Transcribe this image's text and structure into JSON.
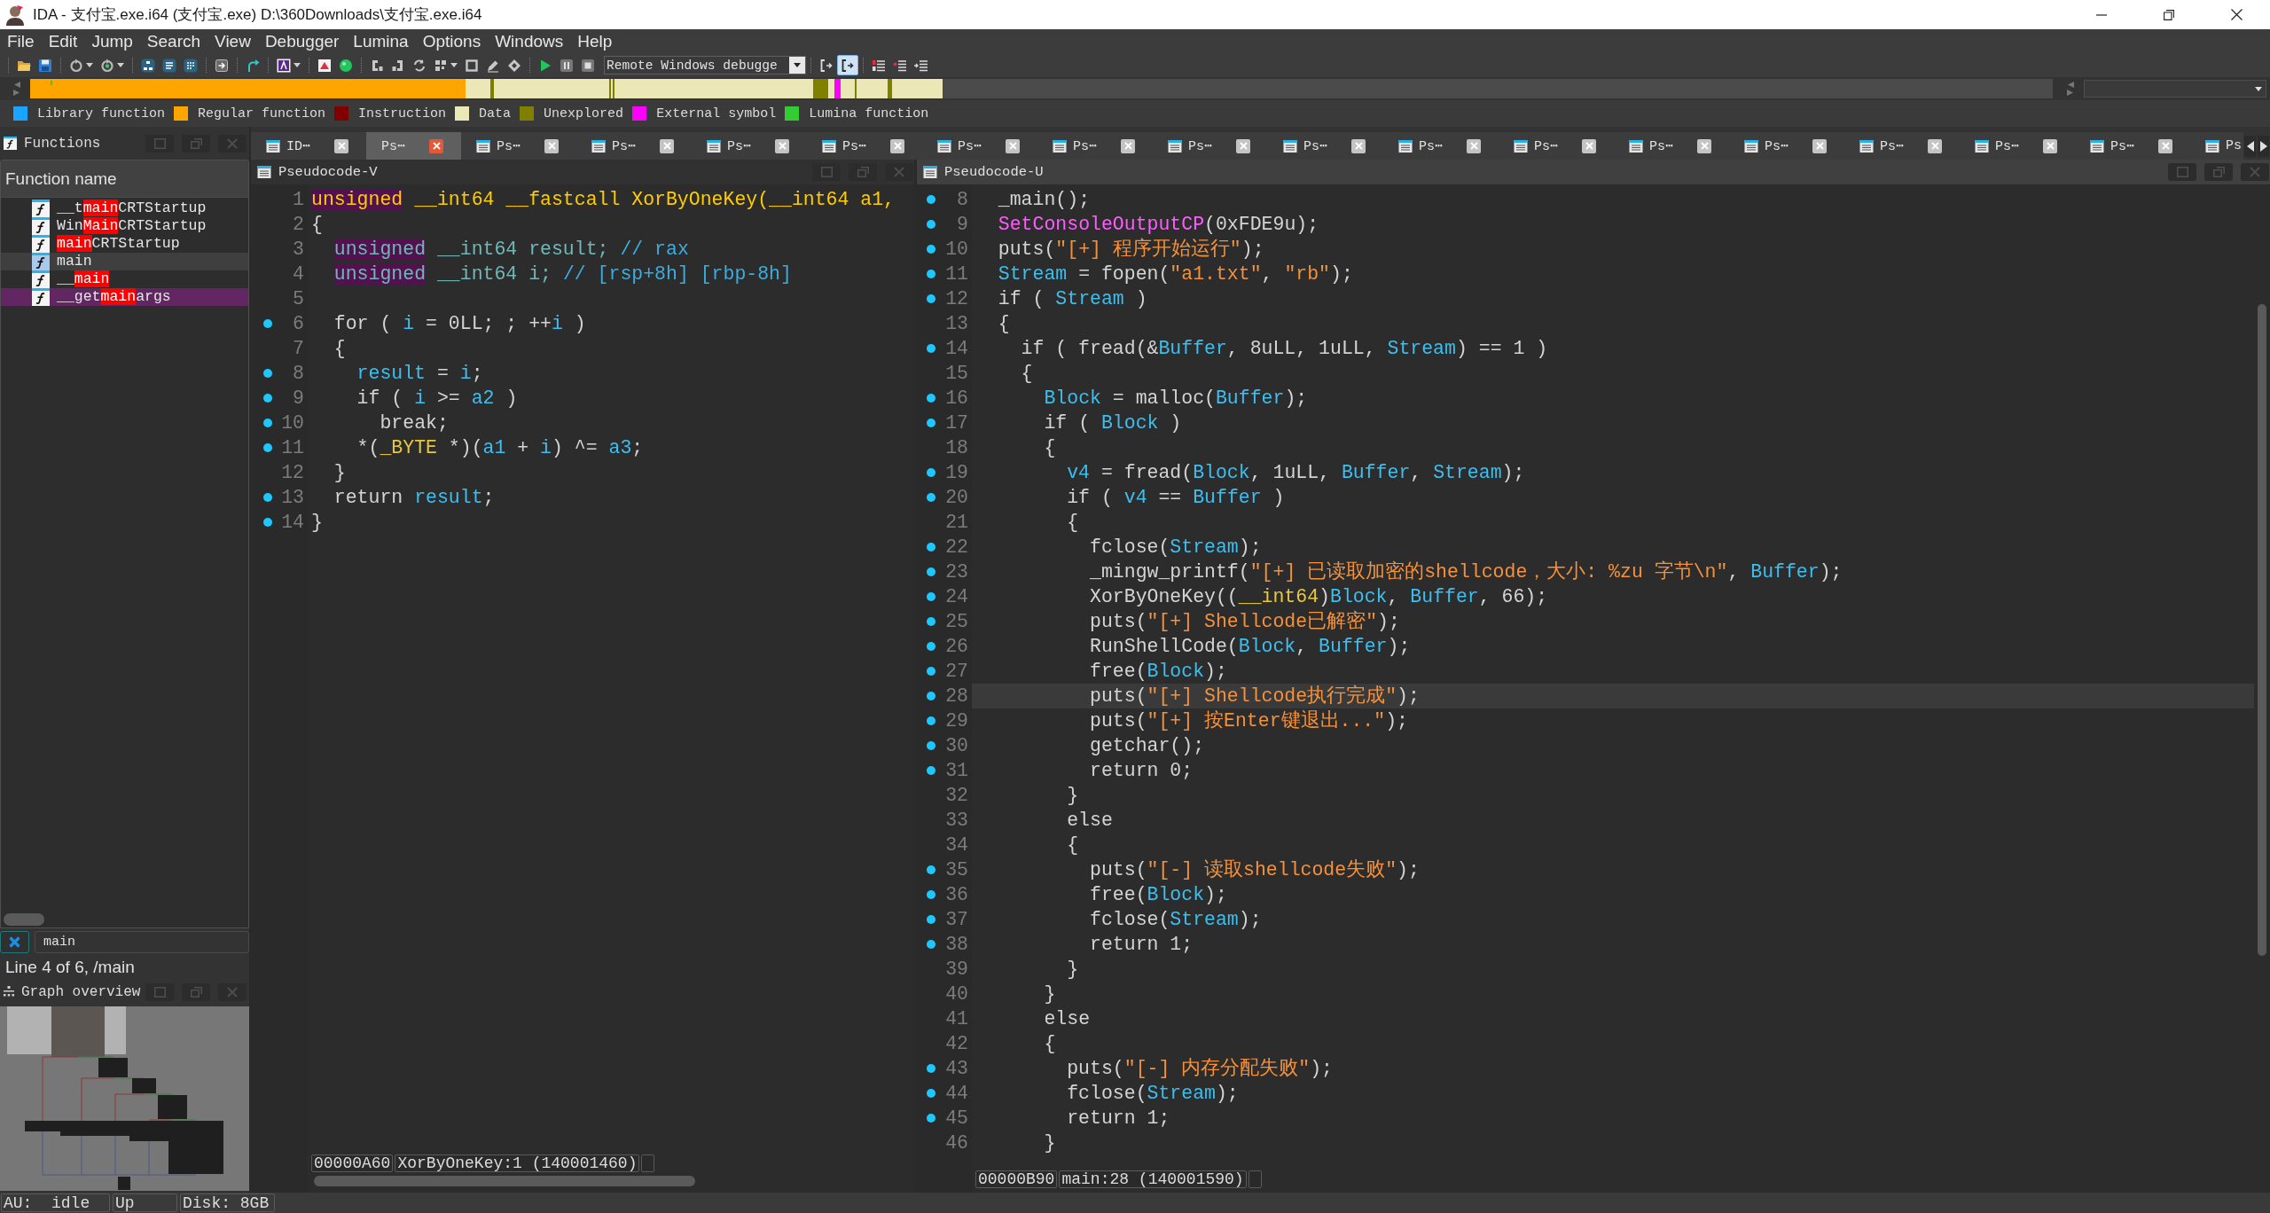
{
  "window": {
    "title": "IDA - 支付宝.exe.i64 (支付宝.exe) D:\\360Downloads\\支付宝.exe.i64"
  },
  "menu": [
    "File",
    "Edit",
    "Jump",
    "Search",
    "View",
    "Debugger",
    "Lumina",
    "Options",
    "Windows",
    "Help"
  ],
  "toolbar": {
    "debugger": "Remote Windows debugge",
    "toggles": [
      {
        "on": false
      },
      {
        "on": true
      }
    ]
  },
  "legend": [
    {
      "label": "Library function",
      "color": "#1aa3ff"
    },
    {
      "label": "Regular function",
      "color": "#ffa500"
    },
    {
      "label": "Instruction",
      "color": "#800000"
    },
    {
      "label": "Data",
      "color": "#ebe7b7"
    },
    {
      "label": "Unexplored",
      "color": "#808000"
    },
    {
      "label": "External symbol",
      "color": "#ff00ff"
    },
    {
      "label": "Lumina function",
      "color": "#33cc33"
    }
  ],
  "functions_panel": {
    "title": "Functions",
    "column": "Function name",
    "rows": [
      {
        "selected": false,
        "parts": [
          {
            "kind": "plain",
            "text": "__t"
          },
          {
            "kind": "match",
            "text": "main"
          },
          {
            "kind": "plain",
            "text": "CRTStartup"
          }
        ]
      },
      {
        "selected": false,
        "parts": [
          {
            "kind": "plain",
            "text": "Win"
          },
          {
            "kind": "match",
            "text": "Main"
          },
          {
            "kind": "plain",
            "text": "CRTStartup"
          }
        ]
      },
      {
        "selected": false,
        "parts": [
          {
            "kind": "match",
            "text": "main"
          },
          {
            "kind": "plain",
            "text": "CRTStartup"
          }
        ]
      },
      {
        "selected": true,
        "parts": [
          {
            "kind": "plain",
            "text": "main"
          }
        ]
      },
      {
        "selected": false,
        "parts": [
          {
            "kind": "plain",
            "text": "__"
          },
          {
            "kind": "match",
            "text": "main"
          }
        ]
      },
      {
        "selected": false,
        "color": "#622663",
        "parts": [
          {
            "kind": "plain",
            "text": "__get"
          },
          {
            "kind": "match",
            "text": "main"
          },
          {
            "kind": "plain",
            "text": "args"
          }
        ]
      }
    ],
    "filter": "main",
    "position": "Line 4 of 6, /main"
  },
  "graph_overview": {
    "title": "Graph overview"
  },
  "tabs": [
    {
      "label": "ID⋯",
      "selected": false,
      "closable": true
    },
    {
      "label": "Ps⋯",
      "selected": true,
      "closable": true
    },
    {
      "label": "Ps⋯",
      "selected": false,
      "closable": true
    },
    {
      "label": "Ps⋯",
      "selected": false,
      "closable": true
    },
    {
      "label": "Ps⋯",
      "selected": false,
      "closable": true
    },
    {
      "label": "Ps⋯",
      "selected": false,
      "closable": true
    },
    {
      "label": "Ps⋯",
      "selected": false,
      "closable": true
    },
    {
      "label": "Ps⋯",
      "selected": false,
      "closable": true
    },
    {
      "label": "Ps⋯",
      "selected": false,
      "closable": true
    },
    {
      "label": "Ps⋯",
      "selected": false,
      "closable": true
    },
    {
      "label": "Ps⋯",
      "selected": false,
      "closable": true
    },
    {
      "label": "Ps⋯",
      "selected": false,
      "closable": true
    },
    {
      "label": "Ps⋯",
      "selected": false,
      "closable": true
    },
    {
      "label": "Ps⋯",
      "selected": false,
      "closable": true
    },
    {
      "label": "Ps⋯",
      "selected": false,
      "closable": true
    },
    {
      "label": "Ps⋯",
      "selected": false,
      "closable": true
    },
    {
      "label": "Ps⋯",
      "selected": false,
      "closable": true
    },
    {
      "label": "Ps",
      "selected": false,
      "closable": false
    }
  ],
  "left_view": {
    "title": "Pseudocode-V",
    "active": false,
    "lines": [
      {
        "number": "1",
        "marked": false,
        "selected": false,
        "code": [
          {
            "kind": "signature_match",
            "text": "unsigned"
          },
          {
            "kind": "signature",
            "text": " __int64 __fastcall XorByOneKey(__int64 a1,"
          }
        ]
      },
      {
        "number": "2",
        "marked": false,
        "selected": false,
        "code": [
          {
            "kind": "plain",
            "text": "{"
          }
        ]
      },
      {
        "number": "3",
        "marked": false,
        "selected": false,
        "code": [
          {
            "kind": "type_match",
            "text": "  unsigned"
          },
          {
            "kind": "type",
            "text": " __int64 result; "
          },
          {
            "kind": "comment",
            "text": "// rax"
          }
        ]
      },
      {
        "number": "4",
        "marked": false,
        "selected": false,
        "code": [
          {
            "kind": "type_match",
            "text": "  unsigned"
          },
          {
            "kind": "type",
            "text": " __int64 i; "
          },
          {
            "kind": "comment",
            "text": "// [rsp+8h] [rbp-8h]"
          }
        ]
      },
      {
        "number": "5",
        "marked": false,
        "selected": false
      },
      {
        "number": "6",
        "marked": true,
        "selected": false,
        "code": [
          {
            "kind": "plain",
            "text": "  for ( "
          },
          {
            "kind": "variable",
            "text": "i"
          },
          {
            "kind": "plain",
            "text": " = 0LL; ; ++"
          },
          {
            "kind": "variable",
            "text": "i"
          },
          {
            "kind": "plain",
            "text": " )"
          }
        ]
      },
      {
        "number": "7",
        "marked": false,
        "selected": false,
        "code": [
          {
            "kind": "plain",
            "text": "  {"
          }
        ]
      },
      {
        "number": "8",
        "marked": true,
        "selected": false,
        "code": [
          {
            "kind": "variable",
            "text": "    result"
          },
          {
            "kind": "plain",
            "text": " = "
          },
          {
            "kind": "variable",
            "text": "i"
          },
          {
            "kind": "plain",
            "text": ";"
          }
        ]
      },
      {
        "number": "9",
        "marked": true,
        "selected": false,
        "code": [
          {
            "kind": "plain",
            "text": "    if ( "
          },
          {
            "kind": "variable",
            "text": "i"
          },
          {
            "kind": "plain",
            "text": " >= "
          },
          {
            "kind": "variable",
            "text": "a2"
          },
          {
            "kind": "plain",
            "text": " )"
          }
        ]
      },
      {
        "number": "10",
        "marked": true,
        "selected": false,
        "code": [
          {
            "kind": "plain",
            "text": "      break;"
          }
        ]
      },
      {
        "number": "11",
        "marked": true,
        "selected": false,
        "code": [
          {
            "kind": "plain",
            "text": "    *("
          },
          {
            "kind": "cast",
            "text": "_BYTE"
          },
          {
            "kind": "plain",
            "text": " *)("
          },
          {
            "kind": "variable",
            "text": "a1"
          },
          {
            "kind": "plain",
            "text": " + "
          },
          {
            "kind": "variable",
            "text": "i"
          },
          {
            "kind": "plain",
            "text": ") ^= "
          },
          {
            "kind": "variable",
            "text": "a3"
          },
          {
            "kind": "plain",
            "text": ";"
          }
        ]
      },
      {
        "number": "12",
        "marked": false,
        "selected": false,
        "code": [
          {
            "kind": "plain",
            "text": "  }"
          }
        ]
      },
      {
        "number": "13",
        "marked": true,
        "selected": false,
        "code": [
          {
            "kind": "plain",
            "text": "  return "
          },
          {
            "kind": "variable",
            "text": "result"
          },
          {
            "kind": "plain",
            "text": ";"
          }
        ]
      },
      {
        "number": "14",
        "marked": true,
        "selected": false,
        "code": [
          {
            "kind": "plain",
            "text": "}"
          }
        ]
      }
    ],
    "address": "00000A60",
    "location": "XorByOneKey:1 (140001460)"
  },
  "right_view": {
    "title": "Pseudocode-U",
    "active": true,
    "lines": [
      {
        "number": "8",
        "marked": true,
        "selected": false,
        "code": [
          {
            "kind": "plain",
            "text": "  _main();"
          }
        ]
      },
      {
        "number": "9",
        "marked": true,
        "selected": false,
        "code": [
          {
            "kind": "import",
            "text": "  SetConsoleOutputCP"
          },
          {
            "kind": "plain",
            "text": "(0xFDE9u);"
          }
        ]
      },
      {
        "number": "10",
        "marked": true,
        "selected": false,
        "code": [
          {
            "kind": "plain",
            "text": "  puts("
          },
          {
            "kind": "string",
            "text": "\"[+] 程序开始运行\""
          },
          {
            "kind": "plain",
            "text": ");"
          }
        ]
      },
      {
        "number": "11",
        "marked": true,
        "selected": false,
        "code": [
          {
            "kind": "variable",
            "text": "  Stream"
          },
          {
            "kind": "plain",
            "text": " = fopen("
          },
          {
            "kind": "string",
            "text": "\"a1.txt\""
          },
          {
            "kind": "plain",
            "text": ", "
          },
          {
            "kind": "string",
            "text": "\"rb\""
          },
          {
            "kind": "plain",
            "text": ");"
          }
        ]
      },
      {
        "number": "12",
        "marked": true,
        "selected": false,
        "code": [
          {
            "kind": "plain",
            "text": "  if ( "
          },
          {
            "kind": "variable",
            "text": "Stream"
          },
          {
            "kind": "plain",
            "text": " )"
          }
        ]
      },
      {
        "number": "13",
        "marked": false,
        "selected": false,
        "code": [
          {
            "kind": "plain",
            "text": "  {"
          }
        ]
      },
      {
        "number": "14",
        "marked": true,
        "selected": false,
        "code": [
          {
            "kind": "plain",
            "text": "    if ( fread(&"
          },
          {
            "kind": "variable",
            "text": "Buffer"
          },
          {
            "kind": "plain",
            "text": ", 8uLL, 1uLL, "
          },
          {
            "kind": "variable",
            "text": "Stream"
          },
          {
            "kind": "plain",
            "text": ") == 1 )"
          }
        ]
      },
      {
        "number": "15",
        "marked": false,
        "selected": false,
        "code": [
          {
            "kind": "plain",
            "text": "    {"
          }
        ]
      },
      {
        "number": "16",
        "marked": true,
        "selected": false,
        "code": [
          {
            "kind": "variable",
            "text": "      Block"
          },
          {
            "kind": "plain",
            "text": " = malloc("
          },
          {
            "kind": "variable",
            "text": "Buffer"
          },
          {
            "kind": "plain",
            "text": ");"
          }
        ]
      },
      {
        "number": "17",
        "marked": true,
        "selected": false,
        "code": [
          {
            "kind": "plain",
            "text": "      if ( "
          },
          {
            "kind": "variable",
            "text": "Block"
          },
          {
            "kind": "plain",
            "text": " )"
          }
        ]
      },
      {
        "number": "18",
        "marked": false,
        "selected": false,
        "code": [
          {
            "kind": "plain",
            "text": "      {"
          }
        ]
      },
      {
        "number": "19",
        "marked": true,
        "selected": false,
        "code": [
          {
            "kind": "variable",
            "text": "        v4"
          },
          {
            "kind": "plain",
            "text": " = fread("
          },
          {
            "kind": "variable",
            "text": "Block"
          },
          {
            "kind": "plain",
            "text": ", 1uLL, "
          },
          {
            "kind": "variable",
            "text": "Buffer"
          },
          {
            "kind": "plain",
            "text": ", "
          },
          {
            "kind": "variable",
            "text": "Stream"
          },
          {
            "kind": "plain",
            "text": ");"
          }
        ]
      },
      {
        "number": "20",
        "marked": true,
        "selected": false,
        "code": [
          {
            "kind": "plain",
            "text": "        if ( "
          },
          {
            "kind": "variable",
            "text": "v4"
          },
          {
            "kind": "plain",
            "text": " == "
          },
          {
            "kind": "variable",
            "text": "Buffer"
          },
          {
            "kind": "plain",
            "text": " )"
          }
        ]
      },
      {
        "number": "21",
        "marked": false,
        "selected": false,
        "code": [
          {
            "kind": "plain",
            "text": "        {"
          }
        ]
      },
      {
        "number": "22",
        "marked": true,
        "selected": false,
        "code": [
          {
            "kind": "plain",
            "text": "          fclose("
          },
          {
            "kind": "variable",
            "text": "Stream"
          },
          {
            "kind": "plain",
            "text": ");"
          }
        ]
      },
      {
        "number": "23",
        "marked": true,
        "selected": false,
        "code": [
          {
            "kind": "plain",
            "text": "          _mingw_printf("
          },
          {
            "kind": "string",
            "text": "\"[+] 已读取加密的shellcode，大小: %zu 字节\\n\""
          },
          {
            "kind": "plain",
            "text": ", "
          },
          {
            "kind": "variable",
            "text": "Buffer"
          },
          {
            "kind": "plain",
            "text": ");"
          }
        ]
      },
      {
        "number": "24",
        "marked": true,
        "selected": false,
        "code": [
          {
            "kind": "plain",
            "text": "          XorByOneKey(("
          },
          {
            "kind": "cast",
            "text": "__int64"
          },
          {
            "kind": "plain",
            "text": ")"
          },
          {
            "kind": "variable",
            "text": "Block"
          },
          {
            "kind": "plain",
            "text": ", "
          },
          {
            "kind": "variable",
            "text": "Buffer"
          },
          {
            "kind": "plain",
            "text": ", 66);"
          }
        ]
      },
      {
        "number": "25",
        "marked": true,
        "selected": false,
        "code": [
          {
            "kind": "plain",
            "text": "          puts("
          },
          {
            "kind": "string",
            "text": "\"[+] Shellcode已解密\""
          },
          {
            "kind": "plain",
            "text": ");"
          }
        ]
      },
      {
        "number": "26",
        "marked": true,
        "selected": false,
        "code": [
          {
            "kind": "plain",
            "text": "          RunShellCode("
          },
          {
            "kind": "variable",
            "text": "Block"
          },
          {
            "kind": "plain",
            "text": ", "
          },
          {
            "kind": "variable",
            "text": "Buffer"
          },
          {
            "kind": "plain",
            "text": ");"
          }
        ]
      },
      {
        "number": "27",
        "marked": true,
        "selected": false,
        "code": [
          {
            "kind": "plain",
            "text": "          free("
          },
          {
            "kind": "variable",
            "text": "Block"
          },
          {
            "kind": "plain",
            "text": ");"
          }
        ]
      },
      {
        "number": "28",
        "marked": true,
        "selected": true,
        "code": [
          {
            "kind": "plain",
            "text": "          puts("
          },
          {
            "kind": "string",
            "text": "\"[+] Shellcode执行完成\""
          },
          {
            "kind": "plain",
            "text": ");"
          }
        ]
      },
      {
        "number": "29",
        "marked": true,
        "selected": false,
        "code": [
          {
            "kind": "plain",
            "text": "          puts("
          },
          {
            "kind": "string",
            "text": "\"[+] 按Enter键退出...\""
          },
          {
            "kind": "plain",
            "text": ");"
          }
        ]
      },
      {
        "number": "30",
        "marked": true,
        "selected": false,
        "code": [
          {
            "kind": "plain",
            "text": "          getchar();"
          }
        ]
      },
      {
        "number": "31",
        "marked": true,
        "selected": false,
        "code": [
          {
            "kind": "plain",
            "text": "          return 0;"
          }
        ]
      },
      {
        "number": "32",
        "marked": false,
        "selected": false,
        "code": [
          {
            "kind": "plain",
            "text": "        }"
          }
        ]
      },
      {
        "number": "33",
        "marked": false,
        "selected": false,
        "code": [
          {
            "kind": "plain",
            "text": "        else"
          }
        ]
      },
      {
        "number": "34",
        "marked": false,
        "selected": false,
        "code": [
          {
            "kind": "plain",
            "text": "        {"
          }
        ]
      },
      {
        "number": "35",
        "marked": true,
        "selected": false,
        "code": [
          {
            "kind": "plain",
            "text": "          puts("
          },
          {
            "kind": "string",
            "text": "\"[-] 读取shellcode失败\""
          },
          {
            "kind": "plain",
            "text": ");"
          }
        ]
      },
      {
        "number": "36",
        "marked": true,
        "selected": false,
        "code": [
          {
            "kind": "plain",
            "text": "          free("
          },
          {
            "kind": "variable",
            "text": "Block"
          },
          {
            "kind": "plain",
            "text": ");"
          }
        ]
      },
      {
        "number": "37",
        "marked": true,
        "selected": false,
        "code": [
          {
            "kind": "plain",
            "text": "          fclose("
          },
          {
            "kind": "variable",
            "text": "Stream"
          },
          {
            "kind": "plain",
            "text": ");"
          }
        ]
      },
      {
        "number": "38",
        "marked": true,
        "selected": false,
        "code": [
          {
            "kind": "plain",
            "text": "          return 1;"
          }
        ]
      },
      {
        "number": "39",
        "marked": false,
        "selected": false,
        "code": [
          {
            "kind": "plain",
            "text": "        }"
          }
        ]
      },
      {
        "number": "40",
        "marked": false,
        "selected": false,
        "code": [
          {
            "kind": "plain",
            "text": "      }"
          }
        ]
      },
      {
        "number": "41",
        "marked": false,
        "selected": false,
        "code": [
          {
            "kind": "plain",
            "text": "      else"
          }
        ]
      },
      {
        "number": "42",
        "marked": false,
        "selected": false,
        "code": [
          {
            "kind": "plain",
            "text": "      {"
          }
        ]
      },
      {
        "number": "43",
        "marked": true,
        "selected": false,
        "code": [
          {
            "kind": "plain",
            "text": "        puts("
          },
          {
            "kind": "string",
            "text": "\"[-] 内存分配失败\""
          },
          {
            "kind": "plain",
            "text": ");"
          }
        ]
      },
      {
        "number": "44",
        "marked": true,
        "selected": false,
        "code": [
          {
            "kind": "plain",
            "text": "        fclose("
          },
          {
            "kind": "variable",
            "text": "Stream"
          },
          {
            "kind": "plain",
            "text": ");"
          }
        ]
      },
      {
        "number": "45",
        "marked": true,
        "selected": false,
        "code": [
          {
            "kind": "plain",
            "text": "        return 1;"
          }
        ]
      },
      {
        "number": "46",
        "marked": false,
        "selected": false,
        "code": [
          {
            "kind": "plain",
            "text": "      }"
          }
        ]
      }
    ],
    "address": "00000B90",
    "location": "main:28 (140001590)"
  },
  "status_bar": [
    "AU:  idle",
    "Up",
    "Disk: 8GB"
  ]
}
